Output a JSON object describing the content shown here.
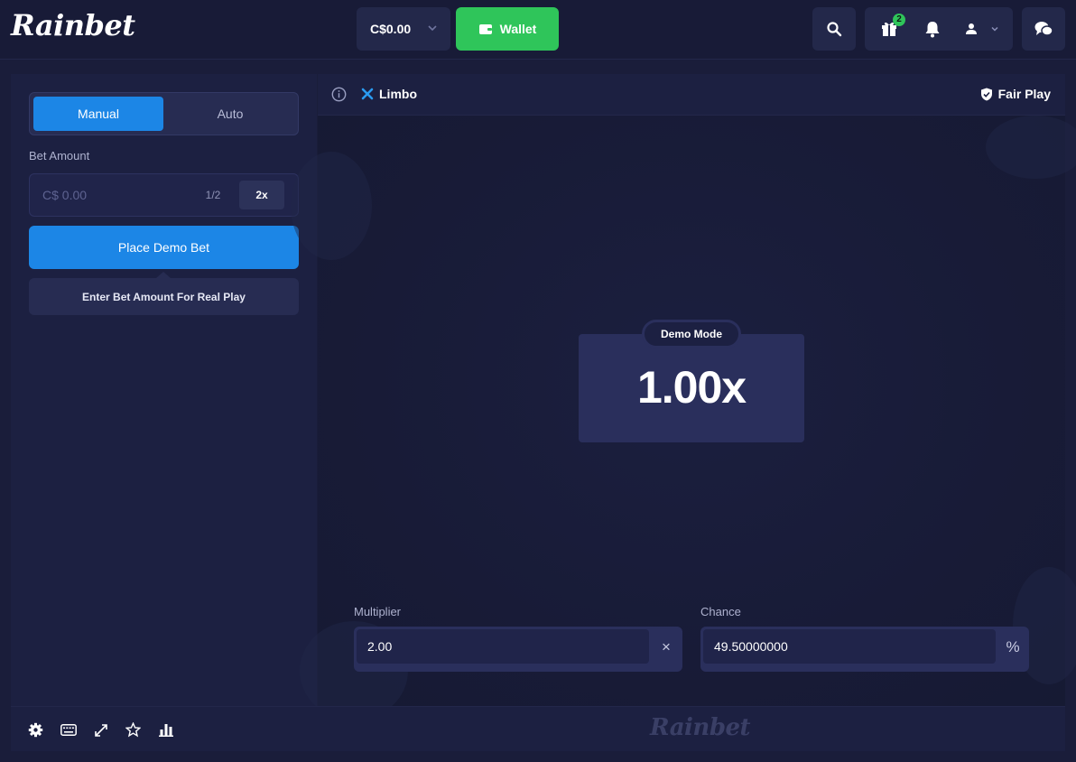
{
  "header": {
    "logo": "Rainbet",
    "balance": "C$0.00",
    "wallet_label": "Wallet",
    "gift_badge": "2",
    "icons": [
      "search-icon",
      "gift-icon",
      "bell-icon",
      "user-icon",
      "chat-icon"
    ]
  },
  "controls": {
    "mode_tabs": [
      {
        "label": "Manual",
        "active": true
      },
      {
        "label": "Auto",
        "active": false
      }
    ],
    "bet_amount_label": "Bet Amount",
    "bet_placeholder": "C$ 0.00",
    "half_label": "1/2",
    "double_label": "2x",
    "place_button_label": "Place Demo Bet",
    "real_play_note": "Enter Bet Amount For Real Play"
  },
  "game": {
    "title": "Limbo",
    "fair_play_label": "Fair Play",
    "demo_mode_label": "Demo Mode",
    "result_multiplier": "1.00x",
    "multiplier_label": "Multiplier",
    "multiplier_value": "2.00",
    "multiplier_suffix": "×",
    "chance_label": "Chance",
    "chance_value": "49.50000000",
    "chance_suffix": "%"
  },
  "footer": {
    "icons": [
      "settings-icon",
      "keyboard-icon",
      "fullscreen-icon",
      "star-icon",
      "stats-icon"
    ],
    "watermark": "Rainbet"
  },
  "colors": {
    "accent_blue": "#1c86e6",
    "wallet_green": "#2fc55a",
    "background": "#1a1d3a"
  }
}
